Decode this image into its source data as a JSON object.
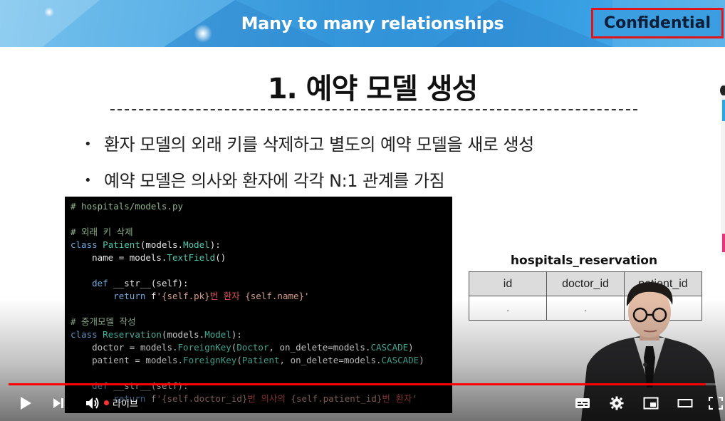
{
  "banner": {
    "title": "Many to many relationships",
    "badge": "Confidential"
  },
  "slide": {
    "heading": "1. 예약 모델 생성",
    "bullets": [
      "환자 모델의 외래 키를 삭제하고 별도의 예약 모델을 새로 생성",
      "예약 모델은 의사와 환자에 각각 N:1 관계를 가짐"
    ],
    "code_lines": [
      "# hospitals/models.py",
      "",
      "# 외래 키 삭제",
      "class Patient(models.Model):",
      "    name = models.TextField()",
      "",
      "    def __str__(self):",
      "        return f'{self.pk}번 환자 {self.name}'",
      "",
      "# 중개모델 작성",
      "class Reservation(models.Model):",
      "    doctor = models.ForeignKey(Doctor, on_delete=models.CASCADE)",
      "    patient = models.ForeignKey(Patient, on_delete=models.CASCADE)",
      "",
      "    def __str__(self):",
      "        return f'{self.doctor_id}번 의사의 {self.patient_id}번 환자'"
    ],
    "table": {
      "caption": "hospitals_reservation",
      "columns": [
        "id",
        "doctor_id",
        "patient_id"
      ],
      "row": [
        ".",
        ".",
        "."
      ]
    }
  },
  "player": {
    "live_label": "라이브",
    "progress_fraction": 0.985,
    "colors": {
      "progress": "#ff0000",
      "banner_border": "#e0141b"
    },
    "icons": [
      "play-icon",
      "next-icon",
      "volume-icon",
      "subtitles-icon",
      "settings-icon",
      "miniplayer-icon",
      "theater-icon",
      "fullscreen-icon"
    ]
  }
}
